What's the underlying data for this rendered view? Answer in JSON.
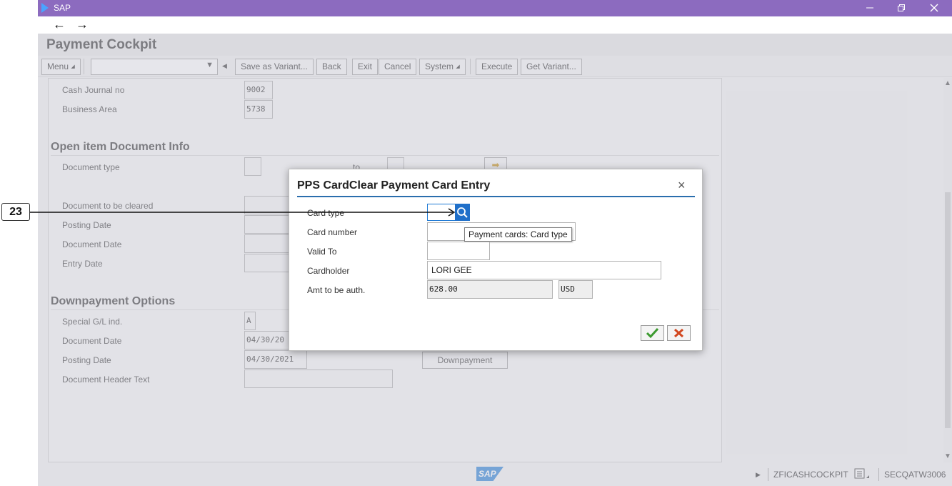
{
  "window": {
    "app_title": "SAP"
  },
  "nav": {
    "back_icon": "←",
    "forward_icon": "→"
  },
  "page": {
    "title": "Payment Cockpit"
  },
  "toolbar": {
    "menu": "Menu",
    "save_variant": "Save as Variant...",
    "back": "Back",
    "exit": "Exit",
    "cancel": "Cancel",
    "system": "System",
    "execute": "Execute",
    "get_variant": "Get Variant...",
    "command_field_value": ""
  },
  "form": {
    "cash_journal_label": "Cash Journal  no",
    "cash_journal_value": "9002",
    "business_area_label": "Business Area",
    "business_area_value": "5738",
    "open_item_section": "Open item Document Info",
    "document_type_label": "Document type",
    "to_label": "to",
    "doc_to_be_cleared_label": "Document to be cleared",
    "posting_date_label": "Posting Date",
    "document_date_label": "Document Date",
    "entry_date_label": "Entry Date",
    "downpayment_section": "Downpayment Options",
    "special_gl_label": "Special G/L ind.",
    "special_gl_value": "A",
    "dp_document_date_label": "Document Date",
    "dp_document_date_value": "04/30/20",
    "dp_posting_date_label": "Posting Date",
    "dp_posting_date_value": "04/30/2021",
    "downpayment_button": "Downpayment",
    "header_text_label": "Document Header Text"
  },
  "dialog": {
    "title": "PPS CardClear Payment Card Entry",
    "close_icon": "×",
    "card_type_label": "Card type",
    "card_type_value": "",
    "card_number_label": "Card number",
    "valid_to_label": "Valid To",
    "cardholder_label": "Cardholder",
    "cardholder_value": "LORI GEE",
    "amount_label": "Amt to be auth.",
    "amount_value": "628.00",
    "currency_value": "USD",
    "tooltip": "Payment cards: Card type"
  },
  "status": {
    "logo": "SAP",
    "transaction": "ZFICASHCOCKPIT",
    "system": "SECQATW3006"
  },
  "annotation": {
    "callout_number": "23"
  },
  "colors": {
    "title_bar": "#8c6bbf",
    "accent_blue": "#1f6fc9",
    "ok_green": "#3c9a2f",
    "cancel_red": "#d2471f"
  }
}
